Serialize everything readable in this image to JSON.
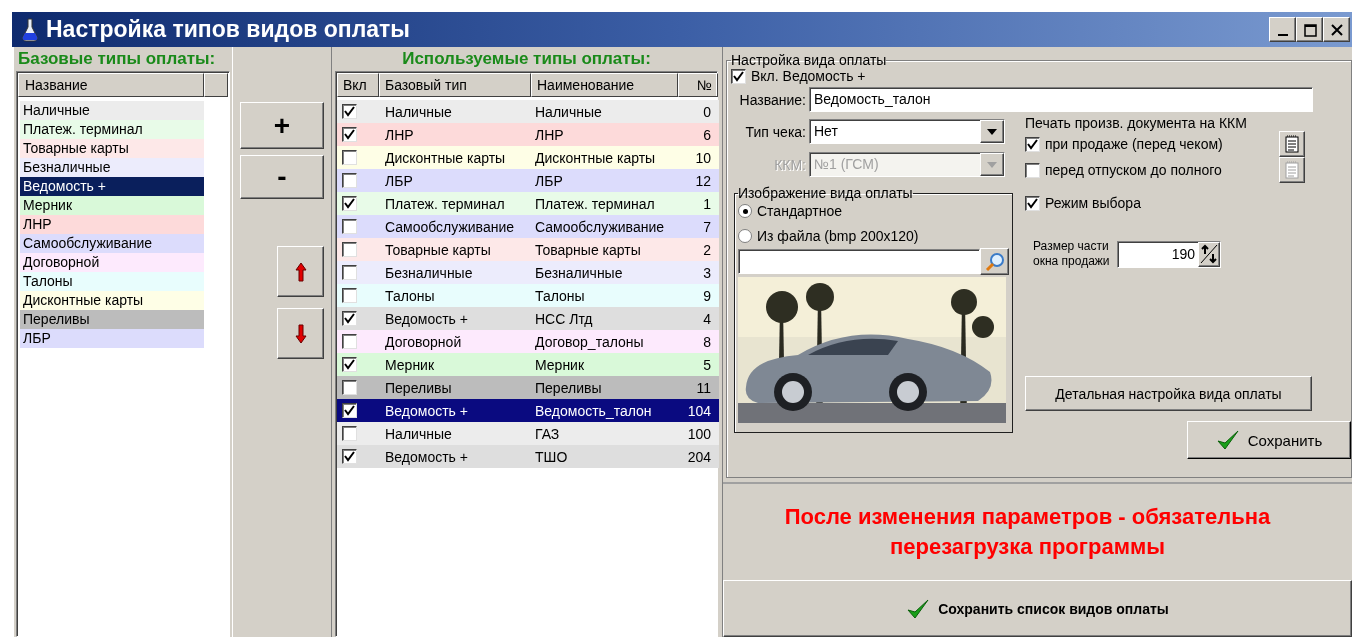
{
  "window": {
    "title": "Настройка типов видов оплаты"
  },
  "base_types": {
    "heading": "Базовые типы оплаты:",
    "columns": [
      "Название"
    ],
    "items": [
      {
        "label": "Наличные",
        "color": "#ececec",
        "selected": false
      },
      {
        "label": "Платеж. терминал",
        "color": "#e8fbe8",
        "selected": false
      },
      {
        "label": "Товарные карты",
        "color": "#fde8e8",
        "selected": false
      },
      {
        "label": "Безналичные",
        "color": "#ececfc",
        "selected": false
      },
      {
        "label": "Ведомость +",
        "selected": true
      },
      {
        "label": "Мерник",
        "color": "#d9f9d9",
        "selected": false
      },
      {
        "label": "ЛНР",
        "color": "#fddada",
        "selected": false
      },
      {
        "label": "Самообслуживание",
        "color": "#dcdcfc",
        "selected": false
      },
      {
        "label": "Договорной",
        "color": "#fdeafd",
        "selected": false
      },
      {
        "label": "Талоны",
        "color": "#e8fdfd",
        "selected": false
      },
      {
        "label": "Дисконтные карты",
        "color": "#fefee6",
        "selected": false
      },
      {
        "label": "Переливы",
        "color": "#bcbcbc",
        "selected": false
      },
      {
        "label": "ЛБР",
        "color": "#dcdcfc",
        "selected": false
      }
    ]
  },
  "move_buttons": {
    "add": "+",
    "remove": "-"
  },
  "used_types": {
    "heading": "Используемые типы оплаты:",
    "columns": [
      "Вкл",
      "Базовый тип",
      "Наименование",
      "№"
    ],
    "rows": [
      {
        "checked": true,
        "base_type": "Наличные",
        "name": "Наличные",
        "number": "0",
        "color": "#ececec",
        "selected": false
      },
      {
        "checked": true,
        "base_type": "ЛНР",
        "name": "ЛНР",
        "number": "6",
        "color": "#fddada",
        "selected": false
      },
      {
        "checked": false,
        "base_type": "Дисконтные карты",
        "name": "Дисконтные карты",
        "number": "10",
        "color": "#fefee6",
        "selected": false
      },
      {
        "checked": false,
        "base_type": "ЛБР",
        "name": "ЛБР",
        "number": "12",
        "color": "#dcdcfc",
        "selected": false
      },
      {
        "checked": true,
        "base_type": "Платеж. терминал",
        "name": "Платеж. терминал",
        "number": "1",
        "color": "#e8fbe8",
        "selected": false
      },
      {
        "checked": false,
        "base_type": "Самообслуживание",
        "name": "Самообслуживание",
        "number": "7",
        "color": "#dcdcfc",
        "selected": false
      },
      {
        "checked": false,
        "base_type": "Товарные карты",
        "name": "Товарные карты",
        "number": "2",
        "color": "#fde8e8",
        "selected": false
      },
      {
        "checked": false,
        "base_type": "Безналичные",
        "name": "Безналичные",
        "number": "3",
        "color": "#ececfc",
        "selected": false
      },
      {
        "checked": false,
        "base_type": "Талоны",
        "name": "Талоны",
        "number": "9",
        "color": "#e8fdfd",
        "selected": false
      },
      {
        "checked": true,
        "base_type": "Ведомость +",
        "name": "НСС Лтд",
        "number": "4",
        "color": "#dedede",
        "selected": false
      },
      {
        "checked": false,
        "base_type": "Договорной",
        "name": "Договор_талоны",
        "number": "8",
        "color": "#fdeafd",
        "selected": false
      },
      {
        "checked": true,
        "base_type": "Мерник",
        "name": "Мерник",
        "number": "5",
        "color": "#d9f9d9",
        "selected": false
      },
      {
        "checked": false,
        "base_type": "Переливы",
        "name": "Переливы",
        "number": "11",
        "color": "#bcbcbc",
        "selected": false
      },
      {
        "checked": true,
        "base_type": "Ведомость +",
        "name": "Ведомость_талон",
        "number": "104",
        "selected": true
      },
      {
        "checked": false,
        "base_type": "Наличные",
        "name": "ГАЗ",
        "number": "100",
        "color": "#ececec",
        "selected": false
      },
      {
        "checked": true,
        "base_type": "Ведомость +",
        "name": "ТШО",
        "number": "204",
        "color": "#dedede",
        "selected": false
      }
    ]
  },
  "settings": {
    "legend": "Настройка вида оплаты",
    "enabled": {
      "label": "Вкл. Ведомость +",
      "checked": true
    },
    "name": {
      "label": "Название:",
      "value": "Ведомость_талон"
    },
    "receipt_type": {
      "label": "Тип чека:",
      "value": "Нет"
    },
    "kkm": {
      "label": "ККМ:",
      "value": "№1 (ГСМ)",
      "disabled": true
    },
    "image": {
      "legend": "Изображение вида оплаты",
      "options": [
        {
          "label": "Стандартное",
          "selected": true
        },
        {
          "label": "Из файла (bmp 200x120)",
          "selected": false
        }
      ]
    },
    "print_doc": {
      "heading": "Печать произв. документа на ККМ",
      "options": [
        {
          "label": "при продаже (перед чеком)",
          "checked": true,
          "button_disabled": false
        },
        {
          "label": "перед отпуском до полного",
          "checked": false,
          "button_disabled": true
        }
      ]
    },
    "selection_mode": {
      "label": "Режим выбора",
      "checked": true
    },
    "sale_part_size": {
      "label": "Размер части окна продажи",
      "value": "190"
    },
    "detail_button": "Детальная настройка вида оплаты",
    "save_button": "Сохранить"
  },
  "notice": "После изменения параметров - обязательна перезагрузка программы",
  "save_list_button": "Сохранить список видов оплаты"
}
